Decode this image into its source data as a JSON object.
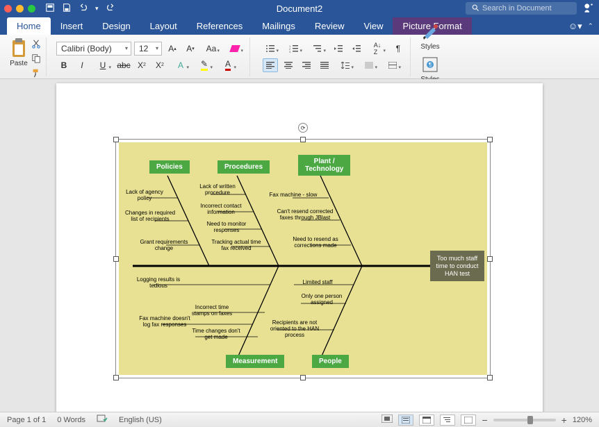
{
  "window": {
    "title": "Document2",
    "search_placeholder": "Search in Document"
  },
  "tabs": {
    "items": [
      "Home",
      "Insert",
      "Design",
      "Layout",
      "References",
      "Mailings",
      "Review",
      "View",
      "Picture Format"
    ],
    "active": 0,
    "contextual": 8
  },
  "ribbon": {
    "paste_label": "Paste",
    "font_name": "Calibri (Body)",
    "font_size": "12",
    "styles_label": "Styles",
    "styles_pane_label": "Styles\nPane"
  },
  "status": {
    "page": "Page 1 of 1",
    "words": "0 Words",
    "lang": "English (US)",
    "zoom": "120%"
  },
  "diagram": {
    "categories": {
      "policies": "Policies",
      "procedures": "Procedures",
      "plant": "Plant /\nTechnology",
      "measurement": "Measurement",
      "people": "People"
    },
    "effect": "Too much staff\ntime to conduct\nHAN test",
    "causes": {
      "policies": [
        "Lack of agency policy",
        "Changes in required list of recipients",
        "Grant requirements change"
      ],
      "procedures": [
        "Lack of written procedure",
        "Incorrect contact information",
        "Need to monitor responses",
        "Tracking actual time fax received"
      ],
      "plant": [
        "Fax machine - slow",
        "Can't resend corrected faxes through JBlast",
        "Need to resend as corrections made"
      ],
      "measurement": [
        "Logging results is tedious",
        "Fax machine doesn't log fax responses",
        "Incorrect time stamps on faxes",
        "Time changes don't get made"
      ],
      "people": [
        "Limited staff",
        "Only one person assigned",
        "Recipients are not oriented to the HAN process"
      ]
    }
  }
}
